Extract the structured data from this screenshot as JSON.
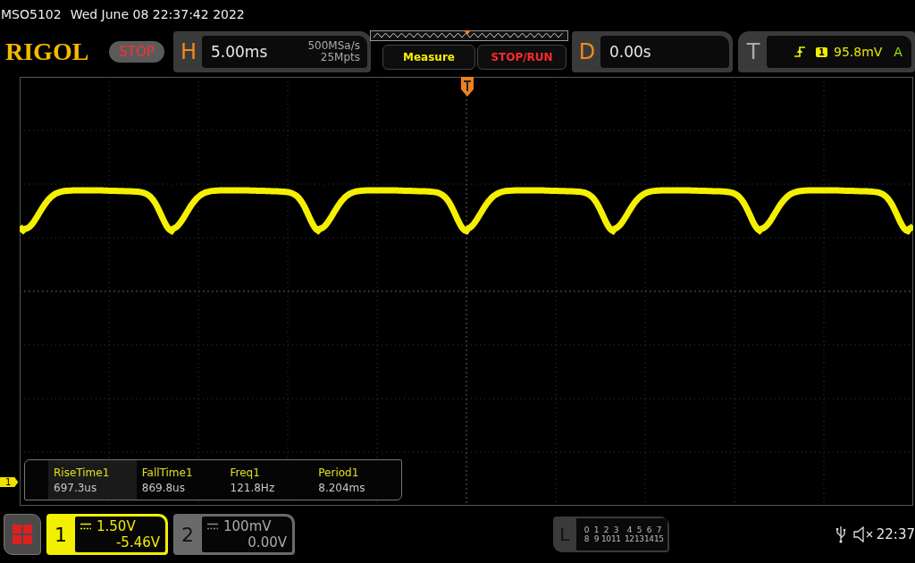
{
  "status_line": {
    "model": "MSO5102",
    "datetime": "Wed June 08 22:37:42 2022"
  },
  "toolbar": {
    "logo": "RIGOL",
    "run_state": "STOP",
    "horizontal": {
      "label": "H",
      "timebase": "5.00ms",
      "sample_rate": "500MSa/s",
      "memory_depth": "25Mpts"
    },
    "measure_button": "Measure",
    "stop_run_button": "STOP/RUN",
    "delay": {
      "label": "D",
      "value": "0.00s"
    },
    "trigger": {
      "label": "T",
      "source": "1",
      "level": "95.8mV",
      "mode": "A"
    }
  },
  "measurements": [
    {
      "name": "RiseTime1",
      "value": "697.3us",
      "selected": true
    },
    {
      "name": "FallTime1",
      "value": "869.8us",
      "selected": false
    },
    {
      "name": "Freq1",
      "value": "121.8Hz",
      "selected": false
    },
    {
      "name": "Period1",
      "value": "8.204ms",
      "selected": false
    }
  ],
  "channel_marker": "1",
  "channels": [
    {
      "number": "1",
      "scale": "1.50V",
      "offset": "-5.46V",
      "enabled": true
    },
    {
      "number": "2",
      "scale": "100mV",
      "offset": "0.00V",
      "enabled": false
    }
  ],
  "logic": {
    "label": "L",
    "rows": [
      [
        "0",
        "1",
        "2",
        "3",
        "4",
        "5",
        "6",
        "7"
      ],
      [
        "8",
        "9",
        "10",
        "11",
        "12",
        "13",
        "14",
        "15"
      ]
    ]
  },
  "clock": "22:37"
}
